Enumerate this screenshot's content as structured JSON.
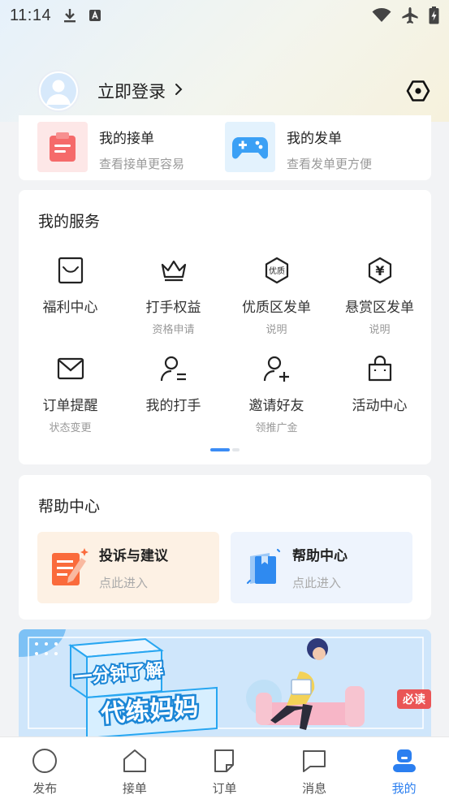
{
  "status_bar": {
    "time": "11:14",
    "icons": [
      "download-icon",
      "text-notification-icon",
      "wifi-icon",
      "airplane-mode-icon",
      "battery-charging-icon"
    ]
  },
  "header": {
    "login_label": "立即登录",
    "settings_icon": "settings-hexagon-icon"
  },
  "orders": {
    "items": [
      {
        "title": "我的接单",
        "subtitle": "查看接单更容易",
        "icon": "clipboard-icon"
      },
      {
        "title": "我的发单",
        "subtitle": "查看发单更方便",
        "icon": "gamepad-icon"
      }
    ]
  },
  "services": {
    "title": "我的服务",
    "items": [
      {
        "label": "福利中心",
        "sub": "",
        "icon": "gift-card-icon"
      },
      {
        "label": "打手权益",
        "sub": "资格申请",
        "icon": "crown-icon"
      },
      {
        "label": "优质区发单",
        "sub": "说明",
        "icon": "quality-badge-icon",
        "badge_text": "优质"
      },
      {
        "label": "悬赏区发单",
        "sub": "说明",
        "icon": "yen-hexagon-icon",
        "badge_text": "¥"
      },
      {
        "label": "订单提醒",
        "sub": "状态变更",
        "icon": "envelope-icon"
      },
      {
        "label": "我的打手",
        "sub": "",
        "icon": "user-list-icon"
      },
      {
        "label": "邀请好友",
        "sub": "领推广金",
        "icon": "user-add-icon"
      },
      {
        "label": "活动中心",
        "sub": "",
        "icon": "shopping-bag-icon"
      }
    ],
    "page_index": 1,
    "page_count": 2
  },
  "help": {
    "title": "帮助中心",
    "tiles": [
      {
        "title": "投诉与建议",
        "subtitle": "点此进入",
        "icon": "complaint-note-icon"
      },
      {
        "title": "帮助中心",
        "subtitle": "点此进入",
        "icon": "help-book-icon"
      }
    ]
  },
  "banner": {
    "line1": "一分钟了解",
    "line2": "代练妈妈",
    "tag": "必读"
  },
  "tabbar": {
    "items": [
      {
        "label": "发布",
        "icon": "circle-icon",
        "active": false
      },
      {
        "label": "接单",
        "icon": "home-icon",
        "active": false
      },
      {
        "label": "订单",
        "icon": "order-note-icon",
        "active": false
      },
      {
        "label": "消息",
        "icon": "message-icon",
        "active": false
      },
      {
        "label": "我的",
        "icon": "profile-icon",
        "active": true
      }
    ]
  },
  "colors": {
    "accent": "#2b7ff0",
    "order_red": "#f56a6a",
    "order_blue": "#3ba0f5",
    "complaint_bg": "#fdf1e4",
    "help_bg": "#eef4fd"
  }
}
